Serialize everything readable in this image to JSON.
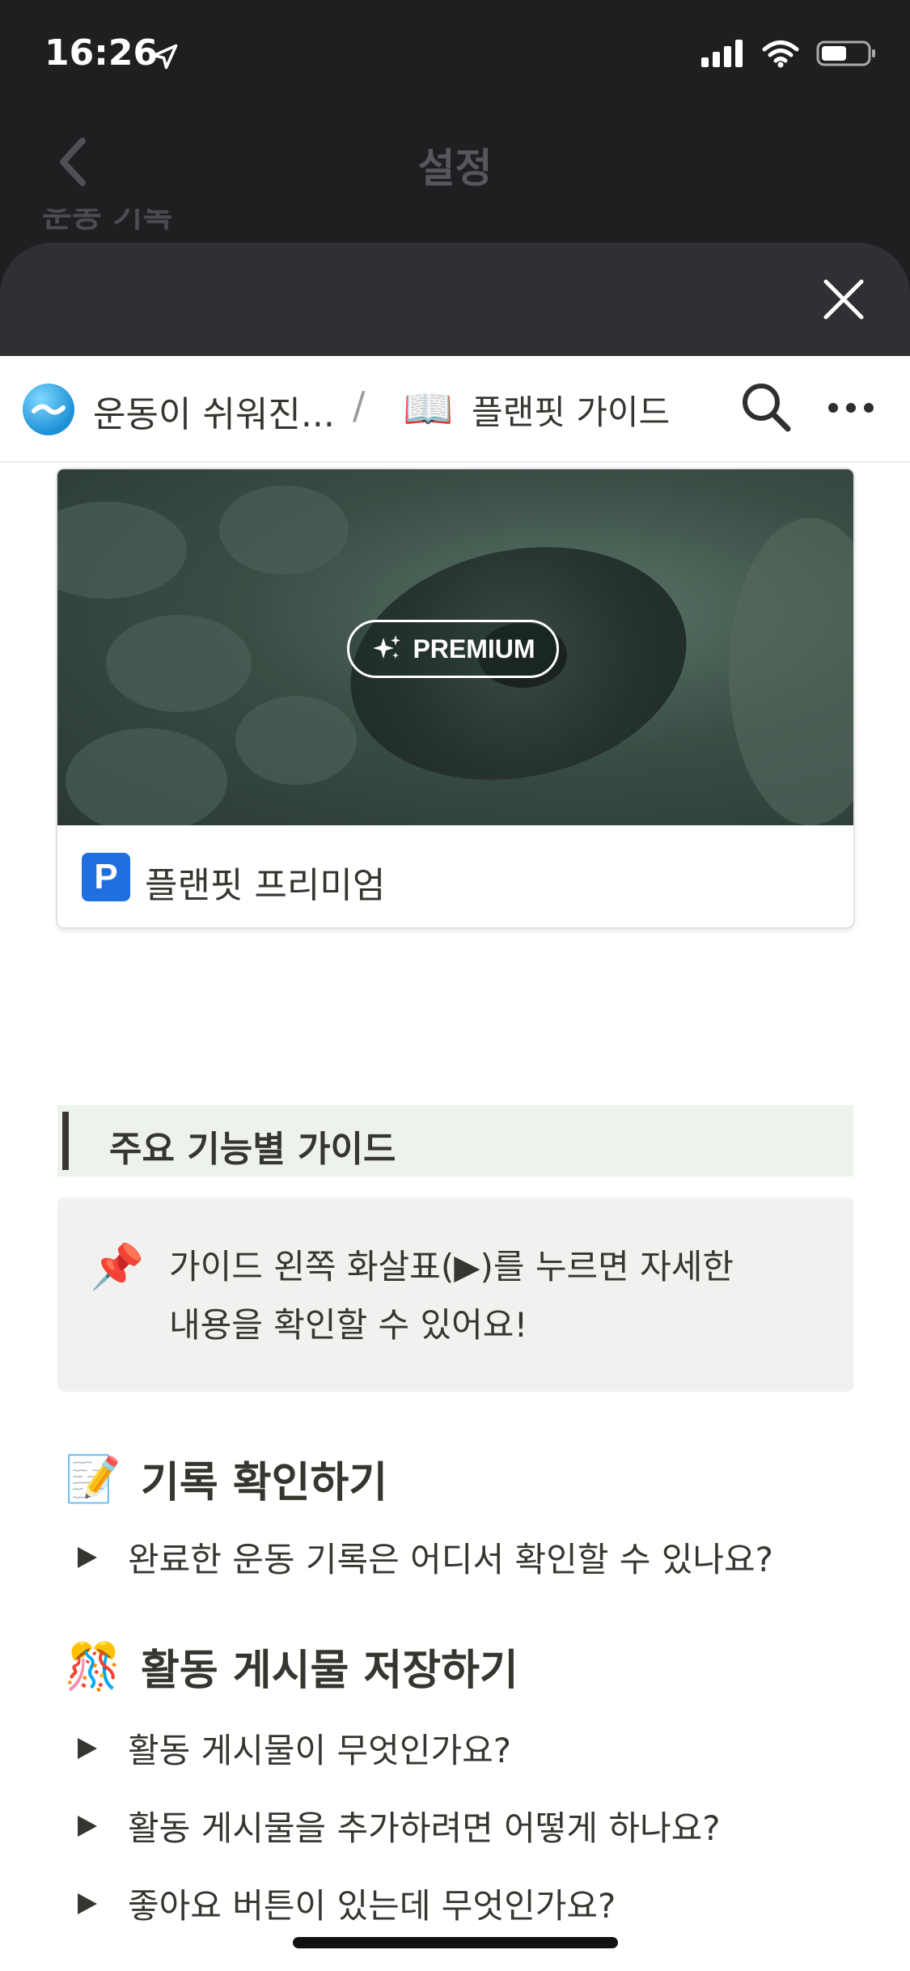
{
  "status_bar": {
    "time": "16:26"
  },
  "background_page": {
    "title": "설정",
    "ghost_text": "운동 기록"
  },
  "sheet": {
    "close_label": "close"
  },
  "topbar": {
    "workspace": "운동이 쉬워진...",
    "separator": "/",
    "page_icon": "📖",
    "page_title": "플랜핏 가이드"
  },
  "premium_card": {
    "badge": "PREMIUM",
    "icon_letter": "P",
    "title": "플랜핏 프리미엄"
  },
  "section_header": "주요 기능별 가이드",
  "callout": {
    "icon": "📌",
    "line1": "가이드 왼쪽 화살표(▶)를 누르면 자세한",
    "line2": "내용을 확인할 수 있어요!"
  },
  "sections": [
    {
      "emoji": "📝",
      "title": "기록 확인하기",
      "toggles": [
        "완료한 운동 기록은 어디서 확인할 수 있나요?"
      ]
    },
    {
      "emoji": "🎊",
      "title": "활동 게시물 저장하기",
      "toggles": [
        "활동 게시물이 무엇인가요?",
        "활동 게시물을 추가하려면 어떻게 하나요?",
        "좋아요 버튼이 있는데 무엇인가요?"
      ]
    }
  ]
}
